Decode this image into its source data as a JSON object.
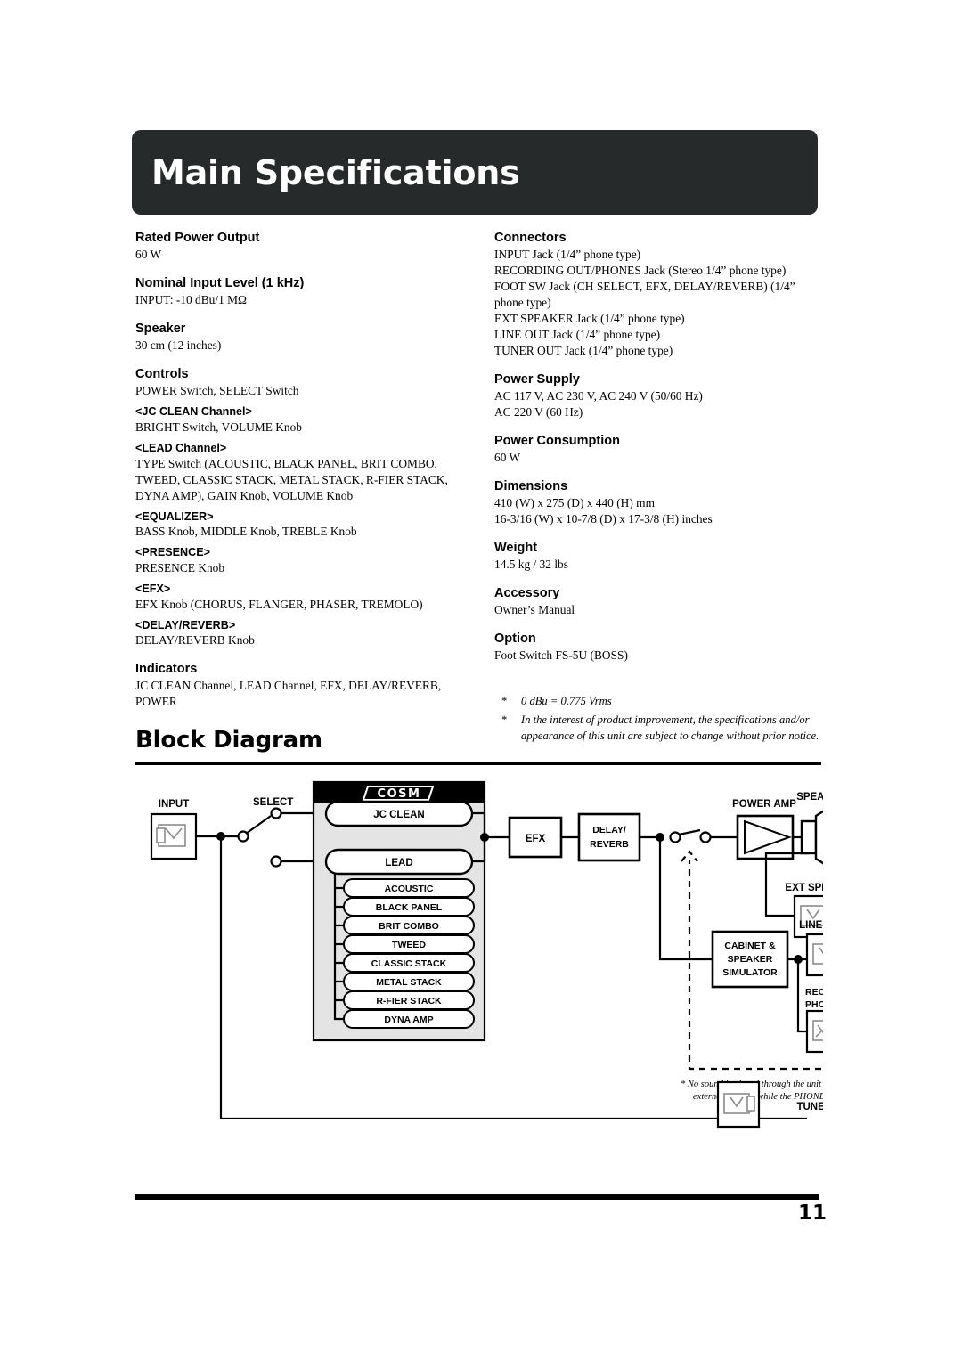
{
  "banner": {
    "title": "Main Specifications"
  },
  "specs": {
    "left": [
      {
        "type": "head",
        "label": "Rated Power Output"
      },
      {
        "type": "text",
        "label": "60 W"
      },
      {
        "type": "head",
        "label": "Nominal Input Level (1 kHz)"
      },
      {
        "type": "text",
        "label": "INPUT: -10 dBu/1 MΩ"
      },
      {
        "type": "head",
        "label": "Speaker"
      },
      {
        "type": "text",
        "label": "30 cm (12 inches)"
      },
      {
        "type": "head",
        "label": "Controls"
      },
      {
        "type": "text",
        "label": "POWER Switch, SELECT Switch"
      },
      {
        "type": "sub",
        "label": "<JC CLEAN Channel>"
      },
      {
        "type": "text",
        "label": "BRIGHT Switch, VOLUME Knob"
      },
      {
        "type": "sub",
        "label": "<LEAD Channel>"
      },
      {
        "type": "text",
        "label": "TYPE Switch (ACOUSTIC, BLACK PANEL, BRIT COMBO, TWEED, CLASSIC STACK, METAL STACK, R-FIER STACK, DYNA AMP), GAIN Knob, VOLUME Knob"
      },
      {
        "type": "sub",
        "label": "<EQUALIZER>"
      },
      {
        "type": "text",
        "label": "BASS Knob, MIDDLE Knob, TREBLE Knob"
      },
      {
        "type": "sub",
        "label": "<PRESENCE>"
      },
      {
        "type": "text",
        "label": "PRESENCE Knob"
      },
      {
        "type": "sub",
        "label": "<EFX>"
      },
      {
        "type": "text",
        "label": "EFX Knob (CHORUS, FLANGER, PHASER, TREMOLO)"
      },
      {
        "type": "sub",
        "label": "<DELAY/REVERB>"
      },
      {
        "type": "text",
        "label": "DELAY/REVERB Knob"
      },
      {
        "type": "head",
        "label": "Indicators"
      },
      {
        "type": "text",
        "label": "JC CLEAN Channel, LEAD Channel, EFX, DELAY/REVERB, POWER"
      }
    ],
    "right": [
      {
        "type": "head",
        "label": "Connectors"
      },
      {
        "type": "text",
        "label": "INPUT Jack (1/4” phone type)"
      },
      {
        "type": "text",
        "label": "RECORDING OUT/PHONES Jack (Stereo 1/4” phone type)"
      },
      {
        "type": "text",
        "label": "FOOT SW Jack (CH SELECT, EFX, DELAY/REVERB) (1/4” phone type)"
      },
      {
        "type": "text",
        "label": "EXT SPEAKER Jack (1/4” phone type)"
      },
      {
        "type": "text",
        "label": "LINE OUT Jack (1/4” phone type)"
      },
      {
        "type": "text",
        "label": "TUNER OUT Jack (1/4” phone type)"
      },
      {
        "type": "head",
        "label": "Power Supply"
      },
      {
        "type": "text",
        "label": "AC 117 V, AC 230 V, AC 240 V (50/60 Hz)"
      },
      {
        "type": "text",
        "label": "AC 220 V (60 Hz)"
      },
      {
        "type": "head",
        "label": "Power Consumption"
      },
      {
        "type": "text",
        "label": "60 W"
      },
      {
        "type": "head",
        "label": "Dimensions"
      },
      {
        "type": "text",
        "label": "410 (W) x 275 (D) x 440 (H) mm"
      },
      {
        "type": "text",
        "label": "16-3/16 (W) x 10-7/8 (D) x 17-3/8 (H) inches"
      },
      {
        "type": "head",
        "label": "Weight"
      },
      {
        "type": "text",
        "label": "14.5 kg / 32 lbs"
      },
      {
        "type": "head",
        "label": "Accessory"
      },
      {
        "type": "text",
        "label": "Owner’s Manual"
      },
      {
        "type": "head",
        "label": "Option"
      },
      {
        "type": "text",
        "label": "Foot Switch FS-5U (BOSS)"
      }
    ],
    "footnotes": [
      "0 dBu = 0.775 Vrms",
      "In the interest of product improvement, the specifications and/or appearance of this unit are subject to change without prior notice."
    ],
    "footnote_marker": "*"
  },
  "block_diagram": {
    "heading": "Block Diagram",
    "labels": {
      "input": "INPUT",
      "select": "SELECT",
      "cosm": "COSM",
      "jc_clean": "JC CLEAN",
      "lead": "LEAD",
      "efx": "EFX",
      "delay_reverb_line1": "DELAY/",
      "delay_reverb_line2": "REVERB",
      "power_amp": "POWER AMP",
      "speaker": "SPEAKER",
      "ext_speaker": "EXT SPEAKER",
      "cabinet_line1": "CABINET &",
      "cabinet_line2": "SPEAKER",
      "cabinet_line3": "SIMULATOR",
      "line_out": "LINE OUT",
      "recording_out_line1": "RECORDING OUT/",
      "recording_out_line2": "PHONES",
      "tuner_out": "TUNER OUT"
    },
    "amp_types": [
      "ACOUSTIC",
      "BLACK PANEL",
      "BRIT COMBO",
      "TWEED",
      "CLASSIC STACK",
      "METAL STACK",
      "R-FIER STACK",
      "DYNA AMP"
    ],
    "note_line1": "* No sound is played through the unit’s speaker and",
    "note_line2": "external speaker while the PHONES jack is in use."
  },
  "footer": {
    "page_number": "11"
  },
  "colors": {
    "banner_bg": "#272a2a",
    "text": "#000000",
    "cosm_panel": "#e4e4e4",
    "rule": "#000000"
  }
}
